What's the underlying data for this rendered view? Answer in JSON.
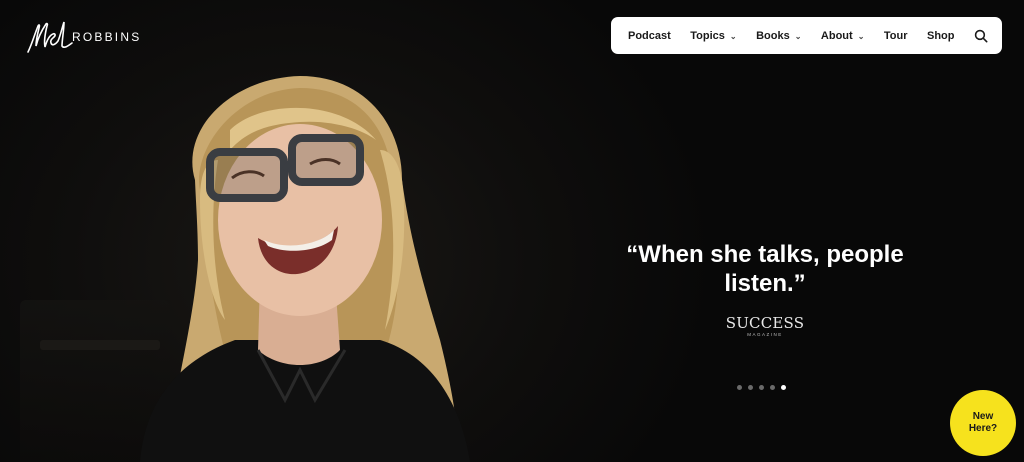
{
  "brand": {
    "script": "Mel",
    "name": "ROBBINS"
  },
  "nav": {
    "items": [
      {
        "label": "Podcast",
        "has_dropdown": false
      },
      {
        "label": "Topics",
        "has_dropdown": true
      },
      {
        "label": "Books",
        "has_dropdown": true
      },
      {
        "label": "About",
        "has_dropdown": true
      },
      {
        "label": "Tour",
        "has_dropdown": false
      },
      {
        "label": "Shop",
        "has_dropdown": false
      }
    ],
    "search_icon": "search-icon"
  },
  "hero": {
    "quote": "“When she talks, people listen.”",
    "source_name": "SUCCESS",
    "source_sub": "MAGAZINE",
    "slides_total": 5,
    "active_slide": 5
  },
  "cta": {
    "line1": "New",
    "line2": "Here?",
    "color": "#f6e21d"
  },
  "colors": {
    "background": "#0b0b0b",
    "nav_bg": "#ffffff",
    "text": "#ffffff"
  }
}
